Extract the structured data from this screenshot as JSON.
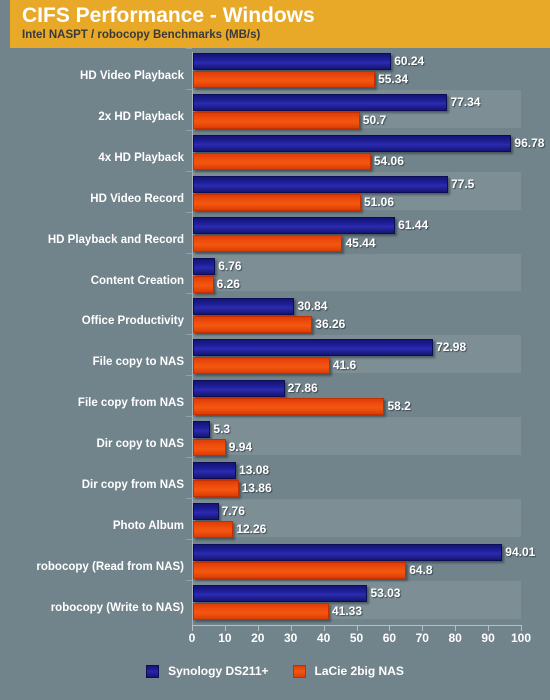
{
  "header": {
    "title": "CIFS Performance - Windows",
    "subtitle": "Intel NASPT / robocopy Benchmarks (MB/s)"
  },
  "legend": {
    "items": [
      {
        "label": "Synology DS211+",
        "color": "#2121a0"
      },
      {
        "label": "LaCie 2big NAS",
        "color": "#ef4f0e"
      }
    ]
  },
  "colors": {
    "background": "#71838b",
    "header": "#e8a828",
    "band": "#7d8e95",
    "series1": "#2121a0",
    "series2": "#ef4f0e",
    "axis": "#b6c0c4",
    "text": "#ffffff"
  },
  "chart_data": {
    "type": "bar",
    "orientation": "horizontal",
    "title": "CIFS Performance - Windows",
    "subtitle": "Intel NASPT / robocopy Benchmarks (MB/s)",
    "xlabel": "",
    "ylabel": "",
    "xlim": [
      0,
      100
    ],
    "xticks": [
      0,
      10,
      20,
      30,
      40,
      50,
      60,
      70,
      80,
      90,
      100
    ],
    "xtick_labels": [
      "0",
      "10",
      "20",
      "30",
      "40",
      "50",
      "60",
      "70",
      "80",
      "90",
      "100"
    ],
    "grid": false,
    "legend_position": "bottom",
    "categories": [
      "HD Video Playback",
      "2x HD Playback",
      "4x HD Playback",
      "HD Video Record",
      "HD Playback and Record",
      "Content Creation",
      "Office Productivity",
      "File copy to NAS",
      "File copy from NAS",
      "Dir copy to NAS",
      "Dir copy from NAS",
      "Photo Album",
      "robocopy (Read from NAS)",
      "robocopy (Write to NAS)"
    ],
    "series": [
      {
        "name": "Synology DS211+",
        "color": "#2121a0",
        "values": [
          60.24,
          77.34,
          96.78,
          77.5,
          61.44,
          6.76,
          30.84,
          72.98,
          27.86,
          5.3,
          13.08,
          7.76,
          94.01,
          53.03
        ],
        "value_labels": [
          "60.24",
          "77.34",
          "96.78",
          "77.5",
          "61.44",
          "6.76",
          "30.84",
          "72.98",
          "27.86",
          "5.3",
          "13.08",
          "7.76",
          "94.01",
          "53.03"
        ]
      },
      {
        "name": "LaCie 2big NAS",
        "color": "#ef4f0e",
        "values": [
          55.34,
          50.7,
          54.06,
          51.06,
          45.44,
          6.26,
          36.26,
          41.6,
          58.2,
          9.94,
          13.86,
          12.26,
          64.8,
          41.33
        ],
        "value_labels": [
          "55.34",
          "50.7",
          "54.06",
          "51.06",
          "45.44",
          "6.26",
          "36.26",
          "41.6",
          "58.2",
          "9.94",
          "13.86",
          "12.26",
          "64.8",
          "41.33"
        ]
      }
    ]
  }
}
